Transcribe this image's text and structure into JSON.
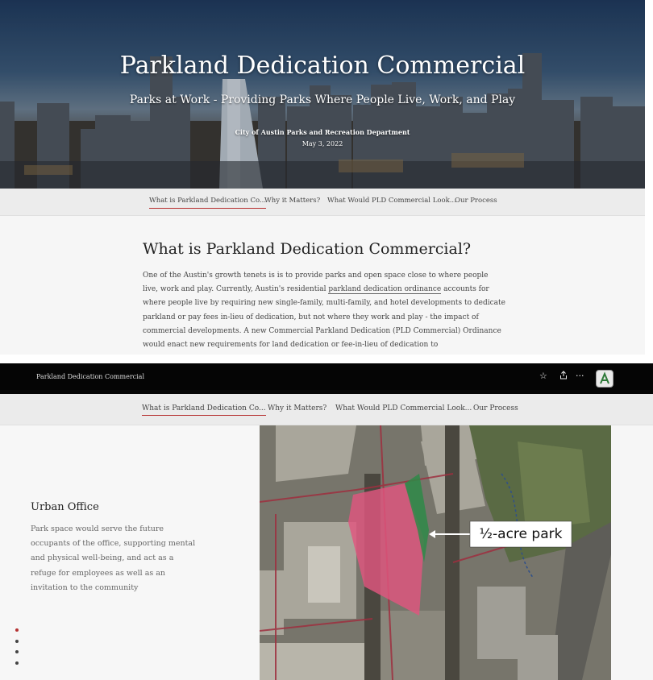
{
  "cover": {
    "title": "Parkland Dedication Commercial",
    "subtitle": "Parks at Work - Providing Parks Where People Live, Work, and Play",
    "organization": "City of Austin Parks and Recreation Department",
    "date": "May 3, 2022"
  },
  "nav": {
    "tabs": [
      {
        "label": "What is Parkland Dedication Co..."
      },
      {
        "label": "Why it Matters?"
      },
      {
        "label": "What Would PLD Commercial Look..."
      },
      {
        "label": "Our Process"
      }
    ],
    "active_index": 0
  },
  "article": {
    "heading": "What is Parkland Dedication Commercial?",
    "body_before": "One of the Austin's growth tenets is is to provide parks and open space close to where people live, work and play. Currently, Austin's residential ",
    "body_link": "parkland dedication ordinance",
    "body_after": " accounts for where people live by requiring new single-family, multi-family, and hotel developments to dedicate parkland or pay fees in-lieu of dedication, but not where they work and play - the impact of commercial developments. A new Commercial Parkland Dedication (PLD Commercial) Ordinance would enact new requirements for land dedication or fee-in-lieu of dedication to"
  },
  "header_bar": {
    "title": "Parkland Dedication Commercial",
    "icons": [
      "star-icon",
      "share-icon",
      "more-icon",
      "app-logo-icon"
    ]
  },
  "section": {
    "heading": "Urban Office",
    "body": "Park space would serve the future occupants of the office, supporting mental and physical well-being, and act as a refuge for employees as well as an invitation to the community"
  },
  "map": {
    "callout": "½-acre park"
  },
  "progress": {
    "count": 4,
    "active_index": 0
  },
  "colors": {
    "accent": "#b52c2c",
    "highlight_pink": "#e0567f",
    "highlight_green": "#2e8a48",
    "topbar": "#050505"
  }
}
